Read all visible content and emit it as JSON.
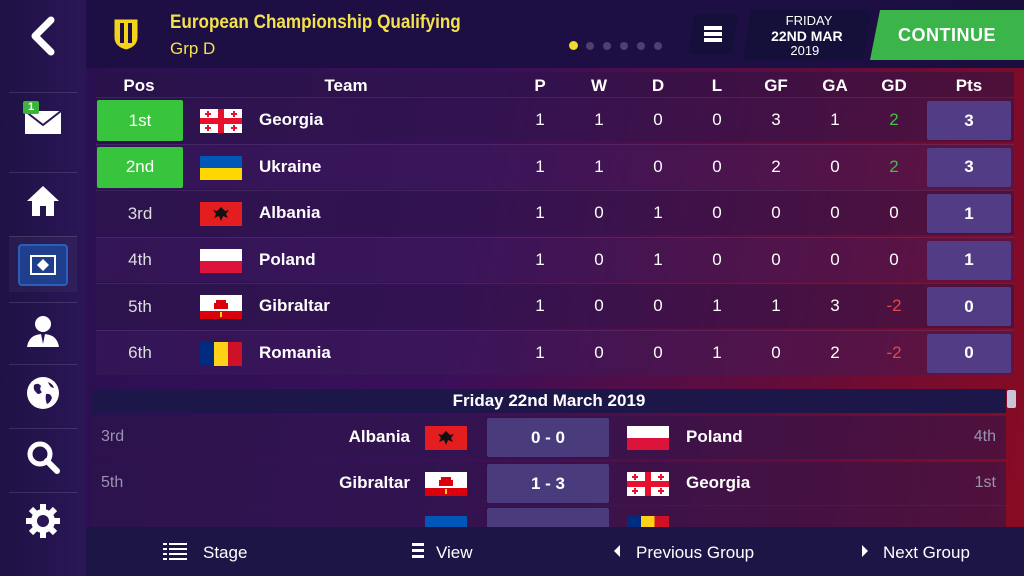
{
  "header": {
    "competition_title": "European Championship Qualifying",
    "group_label": "Grp D",
    "date_day": "FRIDAY",
    "date_main": "22ND MAR",
    "date_year": "2019",
    "continue_label": "CONTINUE",
    "page_dots": 6,
    "active_dot": 0
  },
  "sidebar": {
    "inbox_badge": "1",
    "items": [
      "back-icon",
      "inbox-icon",
      "home-icon",
      "club-icon",
      "manager-icon",
      "globe-icon",
      "search-icon",
      "settings-icon"
    ]
  },
  "table": {
    "columns": [
      "Pos",
      "Team",
      "P",
      "W",
      "D",
      "L",
      "GF",
      "GA",
      "GD",
      "Pts"
    ],
    "rows": [
      {
        "pos": "1st",
        "team": "Georgia",
        "p": "1",
        "w": "1",
        "d": "0",
        "l": "0",
        "gf": "3",
        "ga": "1",
        "gd": "2",
        "pts": "3"
      },
      {
        "pos": "2nd",
        "team": "Ukraine",
        "p": "1",
        "w": "1",
        "d": "0",
        "l": "0",
        "gf": "2",
        "ga": "0",
        "gd": "2",
        "pts": "3"
      },
      {
        "pos": "3rd",
        "team": "Albania",
        "p": "1",
        "w": "0",
        "d": "1",
        "l": "0",
        "gf": "0",
        "ga": "0",
        "gd": "0",
        "pts": "1"
      },
      {
        "pos": "4th",
        "team": "Poland",
        "p": "1",
        "w": "0",
        "d": "1",
        "l": "0",
        "gf": "0",
        "ga": "0",
        "gd": "0",
        "pts": "1"
      },
      {
        "pos": "5th",
        "team": "Gibraltar",
        "p": "1",
        "w": "0",
        "d": "0",
        "l": "1",
        "gf": "1",
        "ga": "3",
        "gd": "-2",
        "pts": "0"
      },
      {
        "pos": "6th",
        "team": "Romania",
        "p": "1",
        "w": "0",
        "d": "0",
        "l": "1",
        "gf": "0",
        "ga": "2",
        "gd": "-2",
        "pts": "0"
      }
    ]
  },
  "fixtures": {
    "date_header": "Friday 22nd March 2019",
    "matches": [
      {
        "home_pos": "3rd",
        "home": "Albania",
        "score": "0 - 0",
        "away": "Poland",
        "away_pos": "4th"
      },
      {
        "home_pos": "5th",
        "home": "Gibraltar",
        "score": "1 - 3",
        "away": "Georgia",
        "away_pos": "1st"
      }
    ]
  },
  "bottom_bar": {
    "stage_label": "Stage",
    "view_label": "View",
    "prev_label": "Previous Group",
    "next_label": "Next Group"
  },
  "colors": {
    "accent_green": "#3bb54a",
    "title_yellow": "#f3e24b",
    "gd_positive": "#43c043",
    "gd_negative": "#e04a4a"
  }
}
